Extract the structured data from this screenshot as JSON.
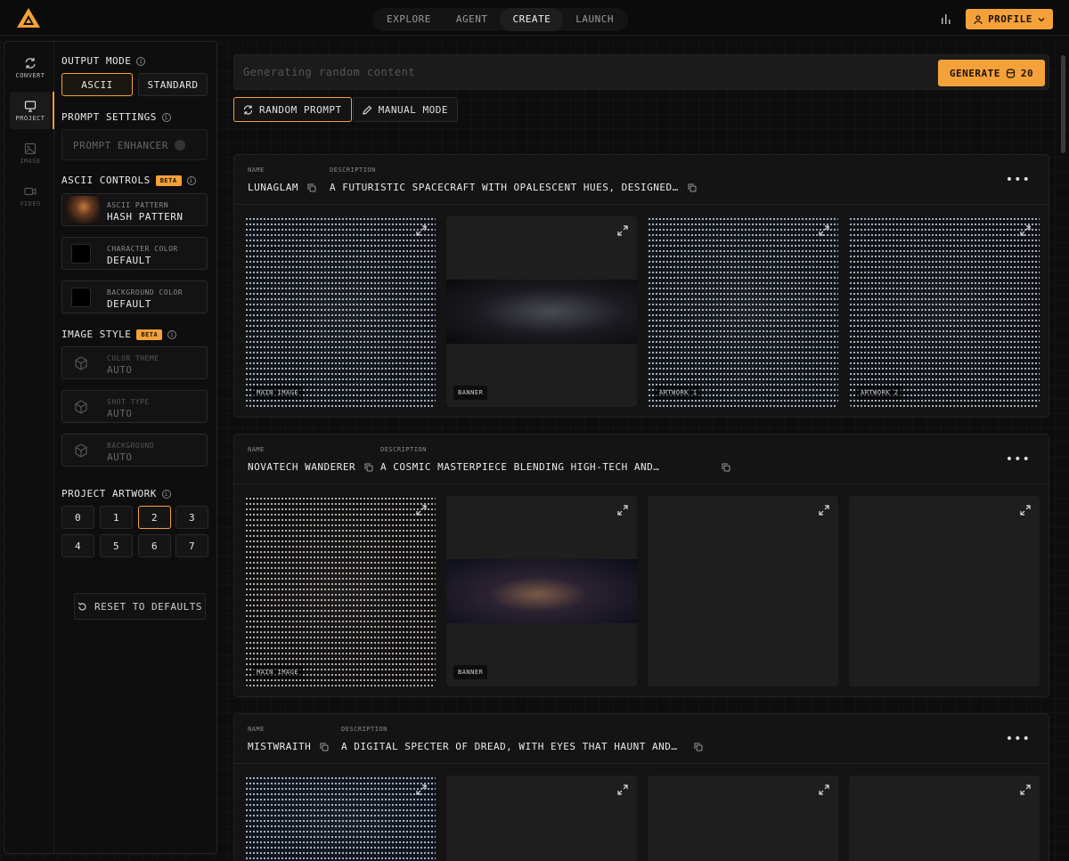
{
  "nav": {
    "items": [
      {
        "label": "EXPLORE",
        "active": false
      },
      {
        "label": "AGENT",
        "active": false
      },
      {
        "label": "CREATE",
        "active": true
      },
      {
        "label": "LAUNCH",
        "active": false
      }
    ],
    "profile_label": "PROFILE"
  },
  "colors": {
    "accent": "#f5a13a",
    "background": "#0d0d0d",
    "panel": "#141414"
  },
  "rail": [
    {
      "label": "CONVERT",
      "icon": "convert-icon",
      "state": "normal"
    },
    {
      "label": "PROJECT",
      "icon": "monitor-icon",
      "state": "active"
    },
    {
      "label": "IMAGE",
      "icon": "image-icon",
      "state": "disabled"
    },
    {
      "label": "VIDEO",
      "icon": "video-icon",
      "state": "disabled"
    }
  ],
  "panel": {
    "output_mode": {
      "title": "OUTPUT MODE",
      "options": [
        "ASCII",
        "STANDARD"
      ],
      "selected": "ASCII"
    },
    "prompt_settings": {
      "title": "PROMPT SETTINGS",
      "enhancer_label": "PROMPT ENHANCER",
      "enhancer_on": false
    },
    "ascii_controls": {
      "title": "ASCII CONTROLS",
      "badge": "BETA",
      "pattern": {
        "label": "ASCII PATTERN",
        "value": "HASH PATTERN"
      },
      "character_color": {
        "label": "CHARACTER COLOR",
        "value": "DEFAULT"
      },
      "background_color": {
        "label": "BACKGROUND COLOR",
        "value": "DEFAULT"
      }
    },
    "image_style": {
      "title": "IMAGE STYLE",
      "badge": "BETA",
      "color_theme": {
        "label": "COLOR THEME",
        "value": "AUTO"
      },
      "shot_type": {
        "label": "SHOT TYPE",
        "value": "AUTO"
      },
      "background": {
        "label": "BACKGROUND",
        "value": "AUTO"
      }
    },
    "project_artwork": {
      "title": "PROJECT ARTWORK",
      "options": [
        "0",
        "1",
        "2",
        "3",
        "4",
        "5",
        "6",
        "7"
      ],
      "selected": "2"
    },
    "reset_label": "RESET TO DEFAULTS"
  },
  "main": {
    "prompt_placeholder": "Generating random content",
    "generate_label": "GENERATE",
    "credits": "20",
    "modes": [
      {
        "label": "RANDOM PROMPT",
        "selected": true
      },
      {
        "label": "MANUAL MODE",
        "selected": false
      }
    ]
  },
  "projects": [
    {
      "name_label": "NAME",
      "name": "LUNAGLAM",
      "description_label": "DESCRIPTION",
      "description": "A FUTURISTIC SPACECRAFT WITH OPALESCENT HUES, DESIGNED…",
      "tiles": [
        "MAIN IMAGE",
        "BANNER",
        "ARTWORK 1",
        "ARTWORK 2"
      ]
    },
    {
      "name_label": "NAME",
      "name": "NOVATECH WANDERER",
      "description_label": "DESCRIPTION",
      "description": "A COSMIC MASTERPIECE BLENDING HIGH-TECH AND…",
      "tiles": [
        "MAIN IMAGE",
        "BANNER"
      ]
    },
    {
      "name_label": "NAME",
      "name": "MISTWRAITH",
      "description_label": "DESCRIPTION",
      "description": "A DIGITAL SPECTER OF DREAD, WITH EYES THAT HAUNT AND…",
      "tiles": []
    }
  ]
}
